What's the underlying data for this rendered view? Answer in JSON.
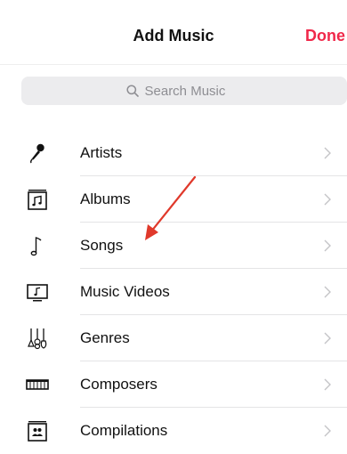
{
  "header": {
    "title": "Add Music",
    "done_label": "Done"
  },
  "search": {
    "placeholder": "Search Music",
    "icon": "search-icon"
  },
  "colors": {
    "accent": "#f0284a",
    "annotation_arrow": "#e0392b"
  },
  "list": {
    "items": [
      {
        "label": "Artists",
        "icon": "microphone-icon"
      },
      {
        "label": "Albums",
        "icon": "album-icon"
      },
      {
        "label": "Songs",
        "icon": "music-note-icon"
      },
      {
        "label": "Music Videos",
        "icon": "music-video-icon"
      },
      {
        "label": "Genres",
        "icon": "guitars-icon"
      },
      {
        "label": "Composers",
        "icon": "piano-icon"
      },
      {
        "label": "Compilations",
        "icon": "compilation-icon"
      }
    ]
  }
}
